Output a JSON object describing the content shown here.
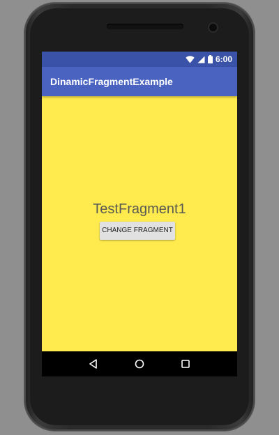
{
  "status_bar": {
    "time": "6:00",
    "icons": [
      "wifi-icon",
      "cell-signal-icon",
      "battery-icon"
    ]
  },
  "app_bar": {
    "title": "DinamicFragmentExample",
    "color": "#4a63c0"
  },
  "content": {
    "background": "#ffeb4d",
    "fragment_label": "TestFragment1",
    "button_label": "CHANGE FRAGMENT"
  },
  "nav_bar": {
    "buttons": [
      "back-icon",
      "home-icon",
      "recents-icon"
    ]
  }
}
